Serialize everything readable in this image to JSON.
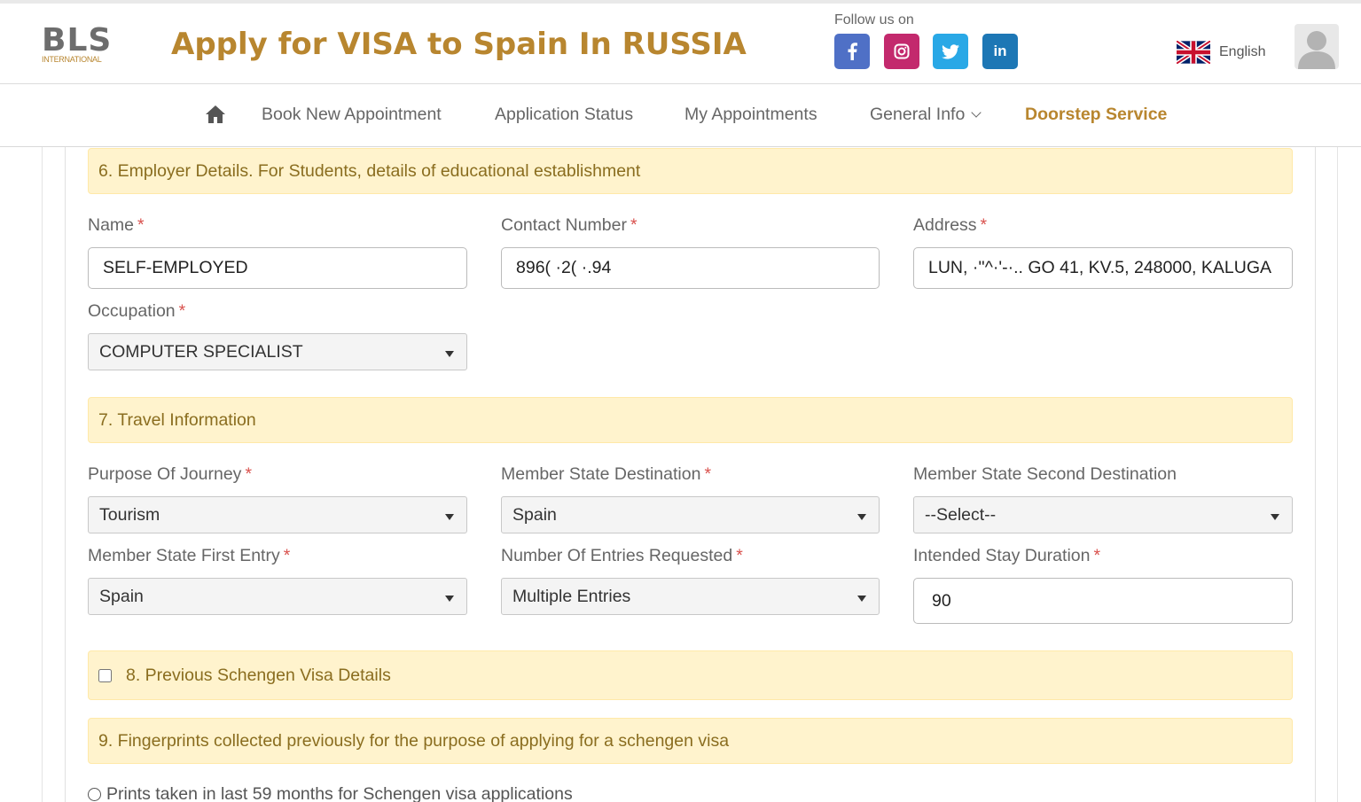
{
  "header": {
    "logo_text": "BLS",
    "logo_sub": "INTERNATIONAL",
    "title": "Apply for VISA to Spain In RUSSIA",
    "follow_label": "Follow us on",
    "social": [
      {
        "name": "facebook",
        "glyph": "f",
        "color": "#4f70c6"
      },
      {
        "name": "instagram",
        "glyph": "◎",
        "color": "#c3296d"
      },
      {
        "name": "twitter",
        "glyph": "🐦",
        "color": "#29a8e6"
      },
      {
        "name": "linkedin",
        "glyph": "in",
        "color": "#1d77b5"
      }
    ],
    "language": "English"
  },
  "nav": {
    "items": [
      {
        "label": "Book New Appointment"
      },
      {
        "label": "Application Status"
      },
      {
        "label": "My Appointments"
      },
      {
        "label": "General Info"
      },
      {
        "label": "Doorstep Service"
      }
    ]
  },
  "sections": {
    "employer": "6. Employer Details. For Students, details of educational establishment",
    "travel": "7. Travel Information",
    "schengen": "8. Previous Schengen Visa Details",
    "fingerprints": "9. Fingerprints collected previously for the purpose of applying for a schengen visa"
  },
  "employer": {
    "name": {
      "label": "Name",
      "value": "SELF-EMPLOYED"
    },
    "contact": {
      "label": "Contact Number",
      "value": "896(  ·2( ·.94"
    },
    "address": {
      "label": "Address",
      "value": "LUN,  ·''^·'-·.. GO 41, KV.5, 248000, KALUGA"
    },
    "occupation": {
      "label": "Occupation",
      "value": "COMPUTER SPECIALIST"
    }
  },
  "travel": {
    "purpose": {
      "label": "Purpose Of Journey",
      "value": "Tourism"
    },
    "destination": {
      "label": "Member State Destination",
      "value": "Spain"
    },
    "second_destination": {
      "label": "Member State Second Destination",
      "value": "--Select--"
    },
    "first_entry": {
      "label": "Member State First Entry",
      "value": "Spain"
    },
    "entries": {
      "label": "Number Of Entries Requested",
      "value": "Multiple Entries"
    },
    "duration": {
      "label": "Intended Stay Duration",
      "value": "90"
    }
  },
  "schengen_checkbox_checked": false,
  "fingerprints_option": "Prints taken in last 59 months for Schengen visa applications",
  "required_marker": "*",
  "colors": {
    "brand": "#b8862f",
    "section_bg": "#fff3cd",
    "section_text": "#8a6d1f",
    "required": "#d9534f"
  }
}
